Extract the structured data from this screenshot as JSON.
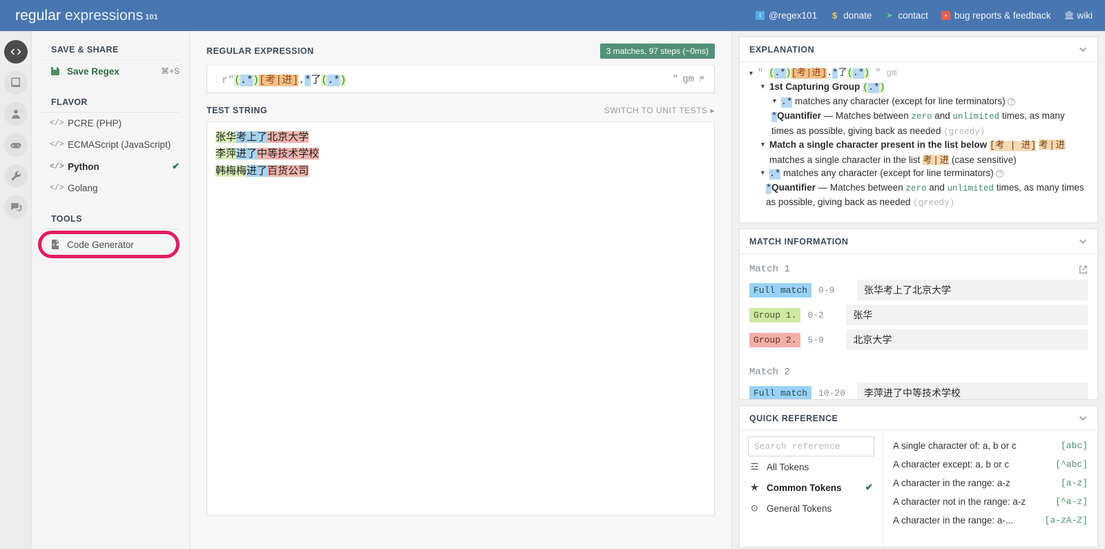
{
  "header": {
    "logo_word1": "regular",
    "logo_word2": "expressions",
    "logo_sup": "101",
    "nav": [
      {
        "label": "@regex101",
        "icon": "twitter-icon",
        "glyph": "t"
      },
      {
        "label": "donate",
        "icon": "dollar-icon",
        "glyph": "$"
      },
      {
        "label": "contact",
        "icon": "paper-plane-icon",
        "glyph": "➤"
      },
      {
        "label": "bug reports & feedback",
        "icon": "bug-icon",
        "glyph": "■"
      },
      {
        "label": "wiki",
        "icon": "bank-icon",
        "glyph": "⌂"
      }
    ]
  },
  "rail": [
    {
      "name": "regex-editor-icon",
      "active": true
    },
    {
      "name": "library-icon",
      "active": false
    },
    {
      "name": "account-icon",
      "active": false
    },
    {
      "name": "gamepad-icon",
      "active": false
    },
    {
      "name": "tools-wrench-icon",
      "active": false
    },
    {
      "name": "comments-icon",
      "active": false
    }
  ],
  "sidebar": {
    "save_share_header": "SAVE & SHARE",
    "save_regex_label": "Save Regex",
    "save_regex_shortcut": "⌘+S",
    "flavor_header": "FLAVOR",
    "flavors": [
      {
        "label": "PCRE (PHP)",
        "selected": false
      },
      {
        "label": "ECMAScript (JavaScript)",
        "selected": false
      },
      {
        "label": "Python",
        "selected": true
      },
      {
        "label": "Golang",
        "selected": false
      }
    ],
    "tools_header": "TOOLS",
    "tools": [
      {
        "label": "Code Generator",
        "highlighted": true
      }
    ],
    "check_glyph": "✔"
  },
  "center": {
    "regex_section_title": "REGULAR EXPRESSION",
    "match_badge": "3 matches, 97 steps (~0ms)",
    "regex_prefix": "r\"",
    "regex_tokens": [
      {
        "t": "(",
        "c": "grp"
      },
      {
        "t": ".*",
        "c": "dot"
      },
      {
        "t": ")",
        "c": "grp"
      },
      {
        "t": "[",
        "c": "cls-br"
      },
      {
        "t": "考|进",
        "c": "cls"
      },
      {
        "t": "]",
        "c": "cls-br"
      },
      {
        "t": ".",
        "c": "lit"
      },
      {
        "t": "*",
        "c": "dot"
      },
      {
        "t": "了",
        "c": "lit"
      },
      {
        "t": "(",
        "c": "grp"
      },
      {
        "t": ".*",
        "c": "dot"
      },
      {
        "t": ")",
        "c": "grp"
      }
    ],
    "regex_close_quote": "\"",
    "flags": "gm",
    "test_section_title": "TEST STRING",
    "switch_unit_tests": "SWITCH TO UNIT TESTS",
    "switch_arrow": "▸",
    "test_lines": [
      [
        {
          "t": "张华",
          "c": "hl-g"
        },
        {
          "t": "考上了",
          "c": "hl-b"
        },
        {
          "t": "北京大学",
          "c": "hl-r"
        }
      ],
      [
        {
          "t": "李萍",
          "c": "hl-g"
        },
        {
          "t": "进了",
          "c": "hl-b"
        },
        {
          "t": "中等技术学校",
          "c": "hl-r"
        }
      ],
      [
        {
          "t": "韩梅梅",
          "c": "hl-g"
        },
        {
          "t": "进了",
          "c": "hl-b"
        },
        {
          "t": "百货公司",
          "c": "hl-r"
        }
      ]
    ]
  },
  "explanation": {
    "title": "EXPLANATION",
    "line_quote": "\"",
    "flags": "gm",
    "group1_label": "1st Capturing Group",
    "dot_desc": "matches any character (except for line terminators)",
    "quantifier_label": "Quantifier",
    "quantifier_dash": "— Matches between",
    "zero": "zero",
    "and": "and",
    "unlimited": "unlimited",
    "times_text": "times, as many times as possible, giving back as needed",
    "greedy": "(greedy)",
    "charclass_title": "Match a single character present in the list below",
    "charclass_token": "[考 | 进]",
    "charclass_inner": "考 | 进",
    "charclass_desc_a": "matches a single character in the list",
    "charclass_desc_b": "(case sensitive)",
    "times_text2": "times, as many times as possible, giving back as needed"
  },
  "match_info": {
    "title": "MATCH INFORMATION",
    "matches": [
      {
        "label": "Match 1",
        "rows": [
          {
            "tag": "Full match",
            "kind": "full",
            "range": "0-9",
            "value": "张华考上了北京大学"
          },
          {
            "tag": "Group 1.",
            "kind": "g1",
            "range": "0-2",
            "value": "张华"
          },
          {
            "tag": "Group 2.",
            "kind": "g2",
            "range": "5-9",
            "value": "北京大学"
          }
        ]
      },
      {
        "label": "Match 2",
        "rows": [
          {
            "tag": "Full match",
            "kind": "full",
            "range": "10-20",
            "value": "李萍进了中等技术学校"
          }
        ]
      }
    ]
  },
  "quick_reference": {
    "title": "QUICK REFERENCE",
    "search_placeholder": "Search reference",
    "search_value": "",
    "categories": [
      {
        "label": "All Tokens",
        "icon": "stack-icon",
        "glyph": "☲",
        "selected": false
      },
      {
        "label": "Common Tokens",
        "icon": "star-icon",
        "glyph": "★",
        "selected": true
      },
      {
        "label": "General Tokens",
        "icon": "target-icon",
        "glyph": "⊙",
        "selected": false
      }
    ],
    "check_glyph": "✔",
    "rows": [
      {
        "desc": "A single character of: a, b or c",
        "token": "[abc]"
      },
      {
        "desc": "A character except: a, b or c",
        "token": "[^abc]"
      },
      {
        "desc": "A character in the range: a-z",
        "token": "[a-z]"
      },
      {
        "desc": "A character not in the range: a-z",
        "token": "[^a-z]"
      },
      {
        "desc": "A character in the range: a-...",
        "token": "[a-zA-Z]"
      }
    ]
  },
  "colors": {
    "topbar": "#4876b0",
    "accent_green": "#529178",
    "annotation_ring": "#e01e64",
    "group1": "#d9edb9",
    "group2": "#f2b3ad",
    "fullmatch": "#a8d3f0"
  }
}
